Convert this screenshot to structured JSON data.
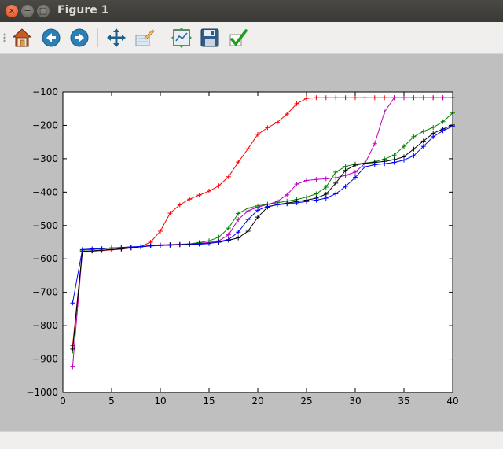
{
  "window": {
    "title": "Figure 1",
    "close_glyph": "×",
    "min_glyph": "−",
    "max_glyph": "□"
  },
  "toolbar": {
    "buttons": [
      {
        "name": "home-button",
        "icon": "home-icon"
      },
      {
        "name": "back-button",
        "icon": "back-arrow-icon"
      },
      {
        "name": "forward-button",
        "icon": "forward-arrow-icon"
      },
      {
        "name": "pan-button",
        "icon": "move-arrows-icon"
      },
      {
        "name": "zoom-button",
        "icon": "zoom-rect-icon"
      },
      {
        "name": "subplots-button",
        "icon": "subplots-icon"
      },
      {
        "name": "save-button",
        "icon": "floppy-disk-icon"
      },
      {
        "name": "edit-button",
        "icon": "checkmark-icon"
      }
    ]
  },
  "chart_data": {
    "type": "line",
    "title": "",
    "xlabel": "",
    "ylabel": "",
    "xlim": [
      0,
      40
    ],
    "ylim": [
      -1000,
      -100
    ],
    "xticks": [
      0,
      5,
      10,
      15,
      20,
      25,
      30,
      35,
      40
    ],
    "yticks": [
      -1000,
      -900,
      -800,
      -700,
      -600,
      -500,
      -400,
      -300,
      -200,
      -100
    ],
    "grid": false,
    "legend": "none",
    "marker": "+",
    "x": [
      1,
      2,
      3,
      4,
      5,
      6,
      7,
      8,
      9,
      10,
      11,
      12,
      13,
      14,
      15,
      16,
      17,
      18,
      19,
      20,
      21,
      22,
      23,
      24,
      25,
      26,
      27,
      28,
      29,
      30,
      31,
      32,
      33,
      34,
      35,
      36,
      37,
      38,
      39,
      40
    ],
    "series": [
      {
        "color": "#ff0000",
        "values": [
          -860,
          -578,
          -577,
          -575,
          -573,
          -571,
          -567,
          -563,
          -550,
          -517,
          -463,
          -438,
          -421,
          -409,
          -397,
          -381,
          -354,
          -310,
          -270,
          -227,
          -207,
          -191,
          -166,
          -135,
          -119,
          -117,
          -117,
          -117,
          -117,
          -117,
          -117,
          -117,
          -117,
          -117,
          -117,
          -117,
          -117,
          -117,
          -117,
          -117
        ]
      },
      {
        "color": "#bf00bf",
        "values": [
          -923,
          -578,
          -576,
          -574,
          -572,
          -569,
          -566,
          -563,
          -560,
          -558,
          -557,
          -556,
          -555,
          -553,
          -551,
          -546,
          -528,
          -482,
          -456,
          -445,
          -437,
          -428,
          -408,
          -376,
          -365,
          -362,
          -360,
          -357,
          -350,
          -340,
          -314,
          -255,
          -160,
          -117,
          -117,
          -117,
          -117,
          -117,
          -117,
          -117
        ]
      },
      {
        "color": "#008000",
        "values": [
          -876,
          -574,
          -572,
          -570,
          -568,
          -567,
          -565,
          -563,
          -561,
          -559,
          -558,
          -557,
          -555,
          -551,
          -546,
          -535,
          -508,
          -464,
          -448,
          -441,
          -436,
          -432,
          -427,
          -422,
          -415,
          -405,
          -385,
          -340,
          -323,
          -316,
          -313,
          -309,
          -301,
          -289,
          -263,
          -234,
          -218,
          -206,
          -189,
          -163
        ]
      },
      {
        "color": "#000000",
        "values": [
          -870,
          -578,
          -576,
          -574,
          -572,
          -570,
          -567,
          -564,
          -561,
          -559,
          -558,
          -557,
          -556,
          -555,
          -553,
          -550,
          -544,
          -537,
          -517,
          -475,
          -445,
          -437,
          -433,
          -428,
          -424,
          -418,
          -406,
          -373,
          -335,
          -319,
          -314,
          -311,
          -308,
          -303,
          -294,
          -271,
          -247,
          -224,
          -211,
          -199
        ]
      },
      {
        "color": "#0000ff",
        "values": [
          -732,
          -572,
          -570,
          -569,
          -567,
          -566,
          -564,
          -563,
          -561,
          -560,
          -559,
          -558,
          -557,
          -556,
          -554,
          -548,
          -542,
          -520,
          -482,
          -454,
          -443,
          -438,
          -435,
          -432,
          -428,
          -424,
          -418,
          -405,
          -383,
          -356,
          -324,
          -318,
          -315,
          -311,
          -304,
          -291,
          -263,
          -234,
          -216,
          -203
        ]
      }
    ]
  }
}
